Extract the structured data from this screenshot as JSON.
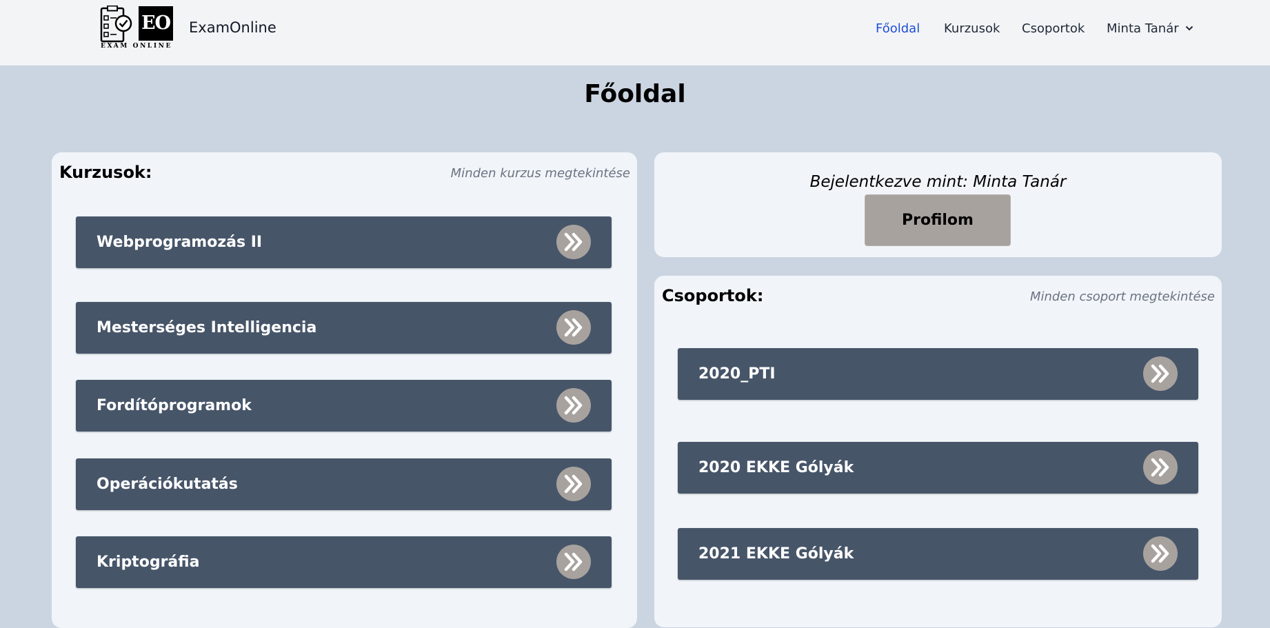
{
  "navbar": {
    "logo": {
      "initials": "EO",
      "caption": "EXAM ONLINE"
    },
    "brand": "ExamOnline",
    "items": [
      {
        "label": "Főoldal",
        "active": true
      },
      {
        "label": "Kurzusok",
        "active": false
      },
      {
        "label": "Csoportok",
        "active": false
      },
      {
        "label": "Minta Tanár",
        "active": false,
        "dropdown": true
      }
    ]
  },
  "page": {
    "title": "Főoldal"
  },
  "courses": {
    "heading": "Kurzusok:",
    "view_all": "Minden kurzus megtekintése",
    "items": [
      {
        "label": "Webprogramozás II"
      },
      {
        "label": "Mesterséges Intelligencia"
      },
      {
        "label": "Fordítóprogramok"
      },
      {
        "label": "Operációkutatás"
      },
      {
        "label": "Kriptográfia"
      }
    ]
  },
  "profile": {
    "logged_in_text": "Bejelentkezve mint: Minta Tanár",
    "button": "Profilom"
  },
  "groups": {
    "heading": "Csoportok:",
    "view_all": "Minden csoport megtekintése",
    "items": [
      {
        "label": "2020_PTI"
      },
      {
        "label": "2020 EKKE Gólyák"
      },
      {
        "label": "2021 EKKE Gólyák"
      }
    ]
  },
  "colors": {
    "background": "#cbd5e1",
    "navbar": "#f3f4f6",
    "panel": "#f1f5f9",
    "card": "#475569",
    "accent_button": "#a8a29e",
    "active_link": "#1d4ed8"
  },
  "icons": {
    "open": "chevron-double-right-icon",
    "dropdown": "chevron-down-icon",
    "logo": "clipboard-check-icon"
  }
}
